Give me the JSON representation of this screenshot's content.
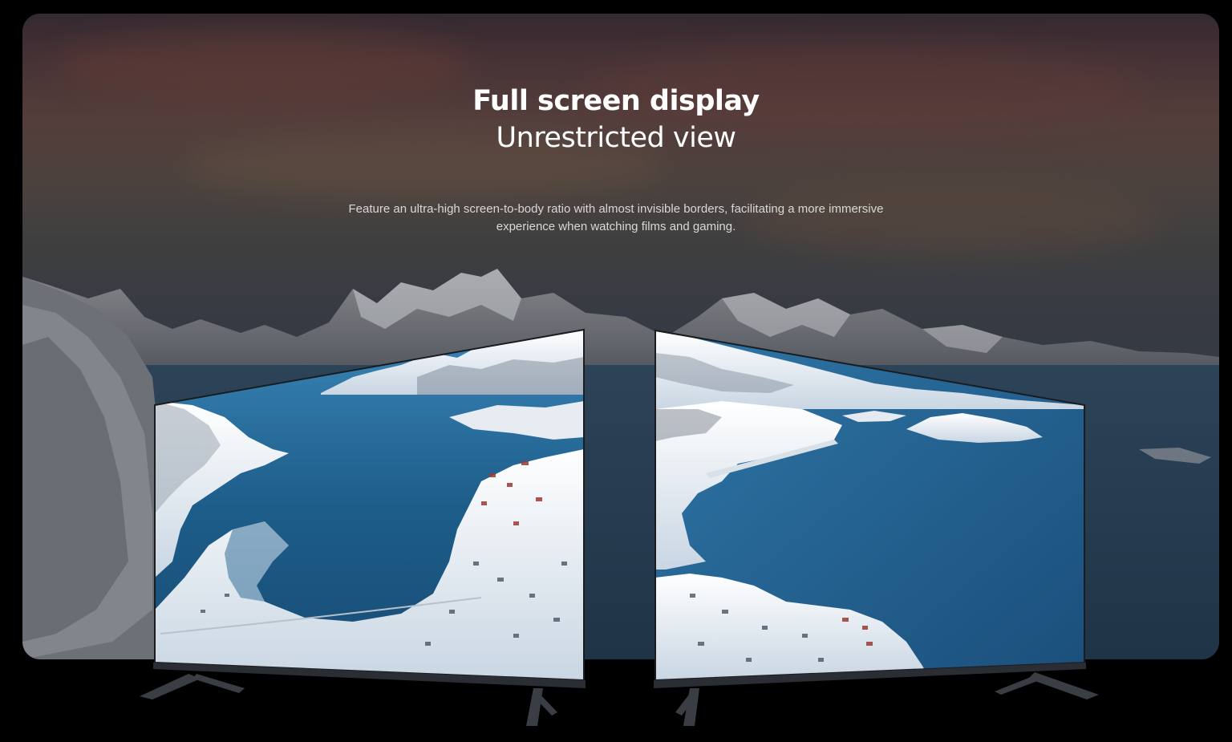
{
  "hero": {
    "title": "Full screen display",
    "subtitle": "Unrestricted view",
    "description": "Feature an ultra-high screen-to-body ratio with almost invisible borders, facilitating a more immersive experience when watching films and gaming."
  },
  "images": {
    "background": "mountain-fjord-landscape",
    "left_tv": "tv-screen-fjord-village",
    "right_tv": "tv-screen-fjord-sea"
  },
  "colors": {
    "page_background": "#000000",
    "text_primary": "#ffffff",
    "text_secondary": "#d8d8d8",
    "water_deep": "#1d5d8a",
    "snow": "#eef2f6"
  }
}
